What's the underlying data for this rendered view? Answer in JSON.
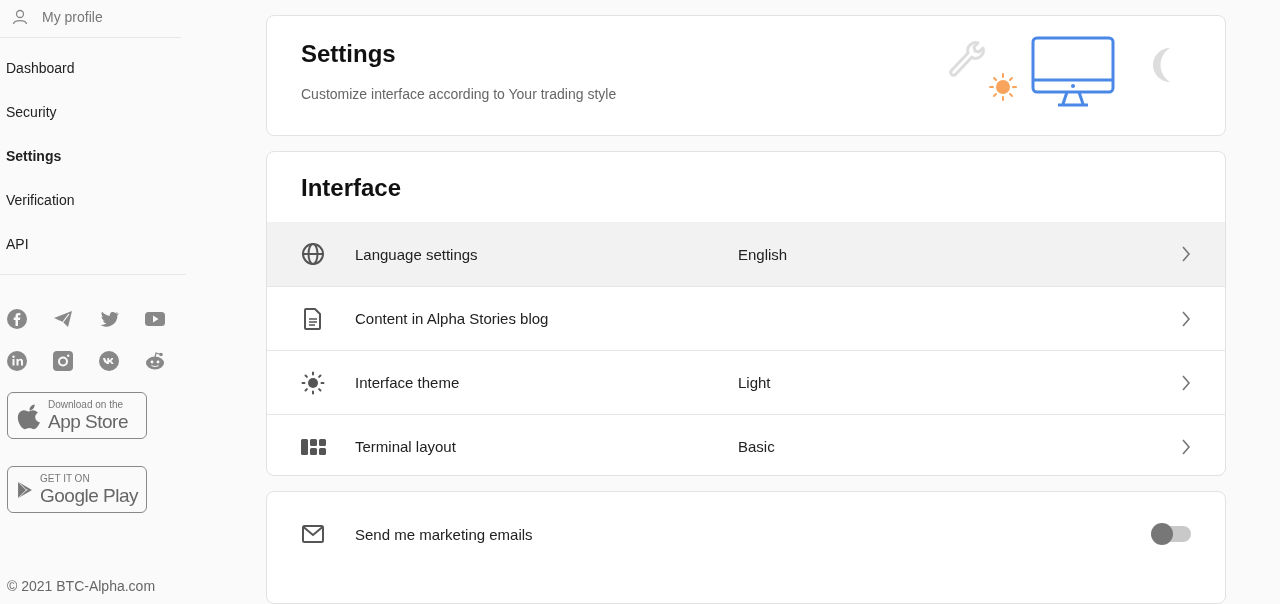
{
  "sidebar": {
    "profile": "My profile",
    "items": [
      {
        "label": "Dashboard",
        "selected": false
      },
      {
        "label": "Security",
        "selected": false
      },
      {
        "label": "Settings",
        "selected": true
      },
      {
        "label": "Verification",
        "selected": false
      },
      {
        "label": "API",
        "selected": false
      }
    ],
    "app_store": {
      "small": "Download on the",
      "big": "App Store"
    },
    "google_play": {
      "small": "GET IT ON",
      "big": "Google Play"
    },
    "copyright": "© 2021 BTC-Alpha.com"
  },
  "header": {
    "title": "Settings",
    "subtitle": "Customize interface according to Your trading style"
  },
  "interface": {
    "title": "Interface",
    "rows": [
      {
        "label": "Language settings",
        "value": "English",
        "highlighted": true
      },
      {
        "label": "Content in Alpha Stories blog",
        "value": "",
        "highlighted": false
      },
      {
        "label": "Interface theme",
        "value": "Light",
        "highlighted": false
      },
      {
        "label": "Terminal layout",
        "value": "Basic",
        "highlighted": false
      }
    ]
  },
  "marketing": {
    "label": "Send me marketing emails",
    "on": false
  }
}
